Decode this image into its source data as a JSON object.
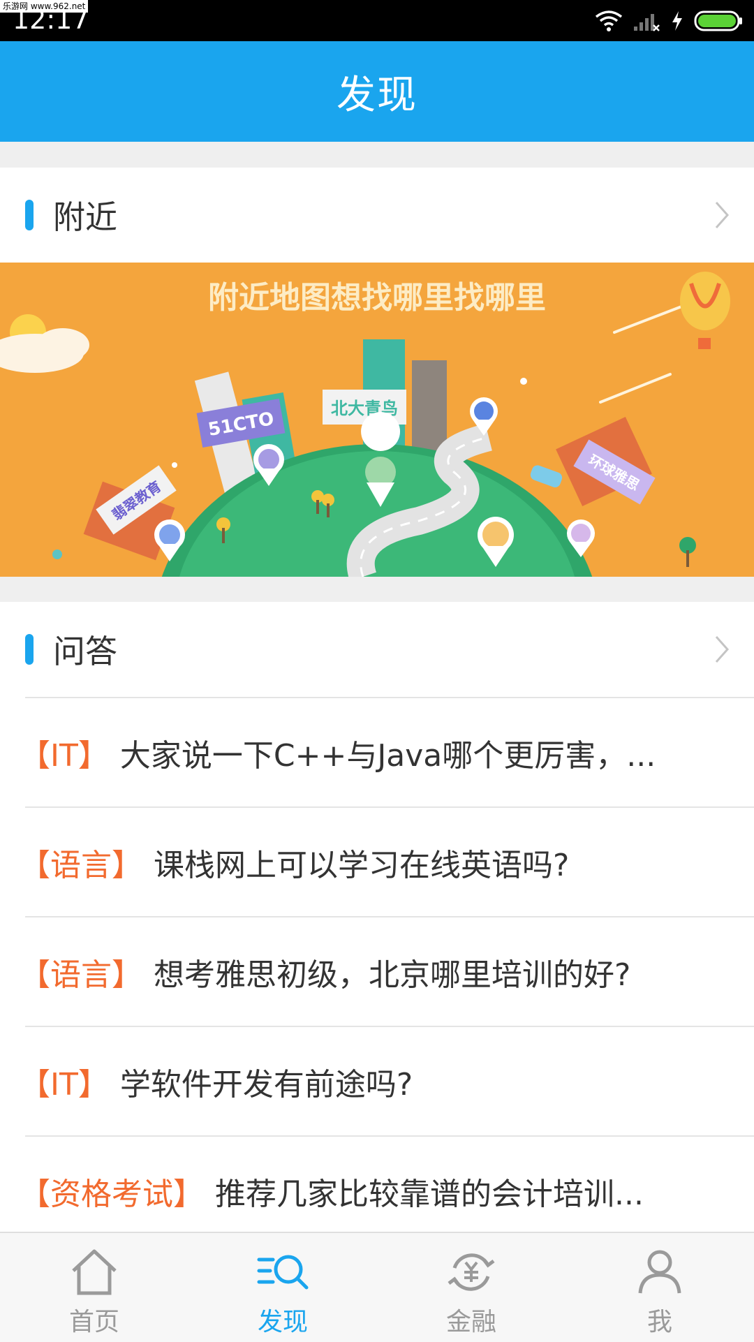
{
  "status_bar": {
    "watermark": "乐游网 www.962.net",
    "time": "12:17"
  },
  "header": {
    "title": "发现"
  },
  "nearby": {
    "label": "附近",
    "banner": {
      "headline": "附近地图想找哪里找哪里",
      "signs": [
        "51CTO",
        "北大青鸟",
        "翡翠教育",
        "环球雅思"
      ]
    }
  },
  "qa": {
    "label": "问答",
    "items": [
      {
        "tag": "【IT】",
        "question": "大家说一下C++与Java哪个更厉害，..."
      },
      {
        "tag": "【语言】",
        "question": "课栈网上可以学习在线英语吗?"
      },
      {
        "tag": "【语言】",
        "question": "想考雅思初级，北京哪里培训的好?"
      },
      {
        "tag": "【IT】",
        "question": "学软件开发有前途吗?"
      },
      {
        "tag": "【资格考试】",
        "question": "推荐几家比较靠谱的会计培训..."
      }
    ]
  },
  "tabbar": {
    "tabs": [
      {
        "label": "首页",
        "icon": "home-icon",
        "active": false
      },
      {
        "label": "发现",
        "icon": "discover-icon",
        "active": true
      },
      {
        "label": "金融",
        "icon": "finance-icon",
        "active": false
      },
      {
        "label": "我",
        "icon": "person-icon",
        "active": false
      }
    ]
  },
  "colors": {
    "accent": "#1aa5ee",
    "tag": "#f26a2e",
    "banner_bg": "#f4a53d"
  }
}
